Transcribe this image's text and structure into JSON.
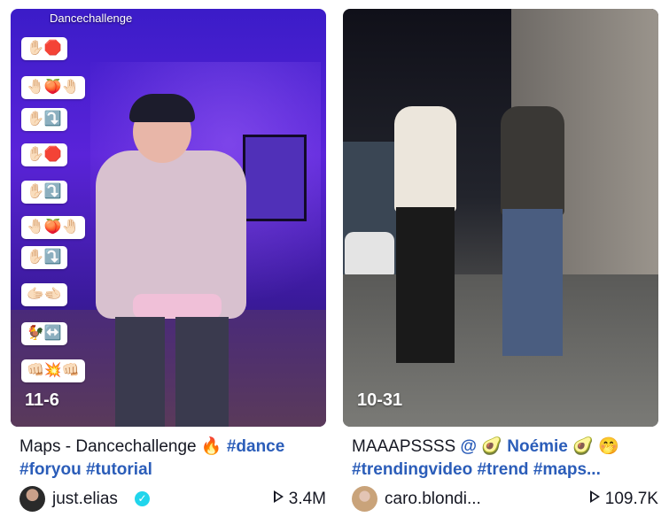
{
  "cards": [
    {
      "overlay_title": "Dancechallenge",
      "date": "11-6",
      "emoji_chips": [
        "✋🏻🛑",
        "🤚🏻🍑🤚🏻",
        "✋🏻⤵️",
        "✋🏻🛑",
        "✋🏻⤵️",
        "🤚🏻🍑🤚🏻",
        "✋🏻⤵️",
        "🫱🏻🫲🏻",
        "🐓↔️",
        "👊🏻💥👊🏻"
      ],
      "caption_text": "Maps - Dancechallenge 🔥 ",
      "tags": [
        "#dance",
        "#foryou",
        "#tutorial"
      ],
      "username": "just.elias",
      "verified": true,
      "views": "3.4M"
    },
    {
      "date": "10-31",
      "caption_text": "MAAAPSSSS ",
      "mention": "@ 🥑 Noémie 🥑",
      "caption_emoji": "🤭",
      "tags": [
        "#trendingvideo",
        "#trend",
        "#maps"
      ],
      "ellipsis": "...",
      "username": "caro.blondi...",
      "verified": false,
      "views": "109.7K"
    }
  ],
  "colors": {
    "tag": "#2b5db9",
    "text": "#161823",
    "verified_badge": "#20d5ec"
  }
}
